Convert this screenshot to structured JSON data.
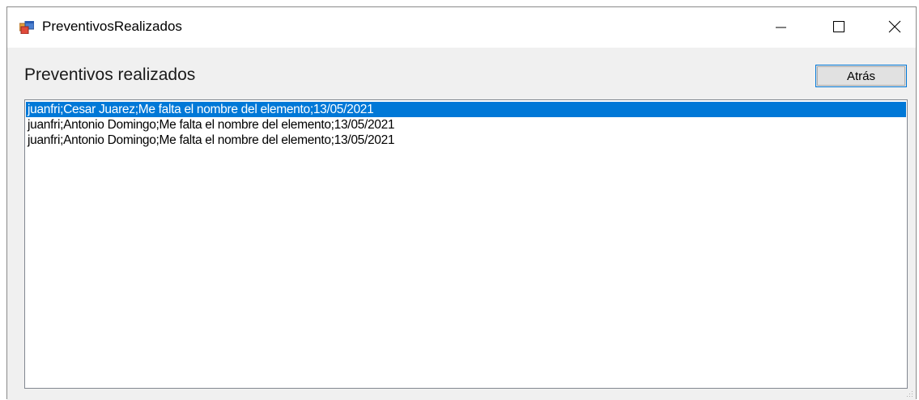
{
  "window": {
    "title": "PreventivosRealizados",
    "icon": "winforms-app-icon"
  },
  "caption_buttons": {
    "minimize": "minimize-icon",
    "maximize": "maximize-icon",
    "close": "close-icon"
  },
  "main": {
    "heading": "Preventivos realizados",
    "back_label": "Atrás",
    "list": {
      "selected_index": 0,
      "items": [
        "juanfri;Cesar Juarez;Me falta el nombre del elemento;13/05/2021",
        "juanfri;Antonio Domingo;Me falta el nombre del elemento;13/05/2021",
        "juanfri;Antonio Domingo;Me falta el nombre del elemento;13/05/2021"
      ]
    }
  },
  "colors": {
    "selection": "#0078d7",
    "client_background": "#f0f0f0"
  }
}
